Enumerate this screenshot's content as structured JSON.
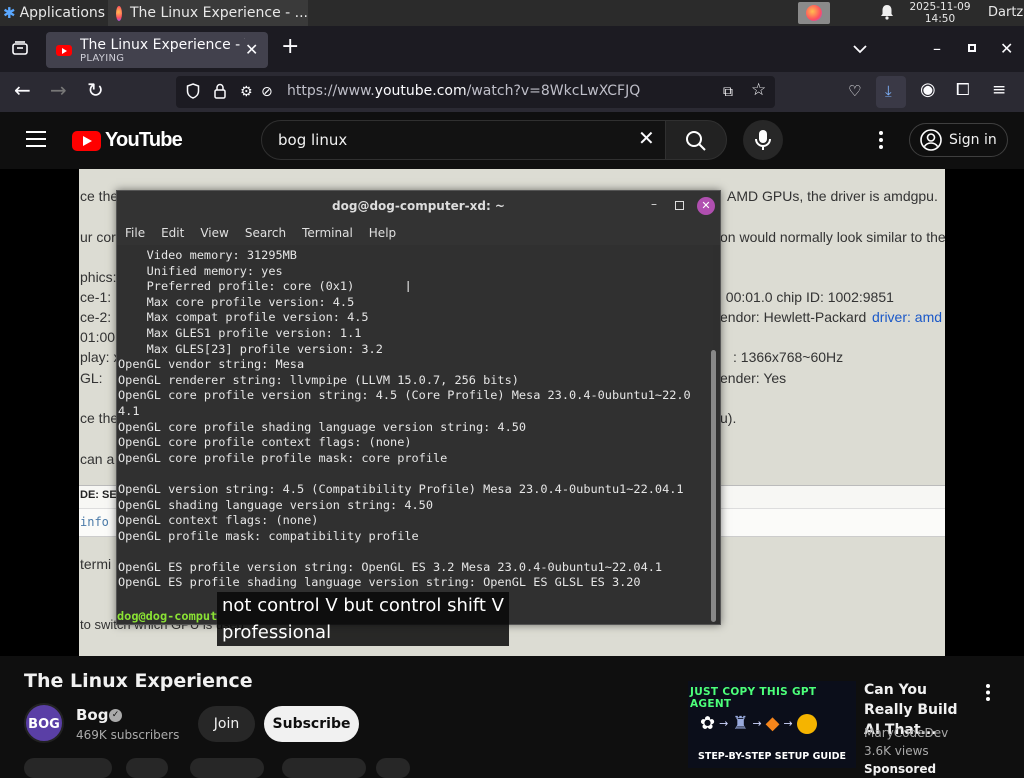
{
  "taskbar": {
    "apps_label": "Applications",
    "window_title": "The Linux Experience - ...",
    "clock_date": "2025-11-09",
    "clock_time": "14:50",
    "user": "Dartz"
  },
  "browser": {
    "tab_title": "The Linux Experience - Y",
    "tab_status": "PLAYING",
    "url_prefix": "https://www.",
    "url_domain": "youtube.com",
    "url_path": "/watch?v=8WkcLwXCFJQ"
  },
  "youtube": {
    "logo_text": "YouTube",
    "search_value": "bog linux",
    "sign_in": "Sign in"
  },
  "slide": {
    "lines": [
      "ce the",
      "AMD GPUs, the driver is amdgpu.",
      "ur cor",
      "on would normally look similar to the",
      "phics:",
      "ce-1:",
      ": 00:01.0 chip ID: 1002:9851",
      "ce-2:",
      "endor: Hewlett-Packard",
      "driver: amd",
      "01:00.",
      "play: x",
      ": 1366x768~60Hz",
      "GL:",
      "ender: Yes",
      "ce the",
      "u).",
      "can a",
      "DE: SE",
      "info",
      "termi",
      "to switch which GPU is used"
    ]
  },
  "terminal": {
    "title": "dog@dog-computer-xd: ~",
    "menu": [
      "File",
      "Edit",
      "View",
      "Search",
      "Terminal",
      "Help"
    ],
    "output": [
      "    Video memory: 31295MB",
      "    Unified memory: yes",
      "    Preferred profile: core (0x1)",
      "    Max core profile version: 4.5",
      "    Max compat profile version: 4.5",
      "    Max GLES1 profile version: 1.1",
      "    Max GLES[23] profile version: 3.2",
      "OpenGL vendor string: Mesa",
      "OpenGL renderer string: llvmpipe (LLVM 15.0.7, 256 bits)",
      "OpenGL core profile version string: 4.5 (Core Profile) Mesa 23.0.4-0ubuntu1~22.0",
      "4.1",
      "OpenGL core profile shading language version string: 4.50",
      "OpenGL core profile context flags: (none)",
      "OpenGL core profile profile mask: core profile",
      "",
      "OpenGL version string: 4.5 (Compatibility Profile) Mesa 23.0.4-0ubuntu1~22.04.1",
      "OpenGL shading language version string: 4.50",
      "OpenGL context flags: (none)",
      "OpenGL profile mask: compatibility profile",
      "",
      "OpenGL ES profile version string: OpenGL ES 3.2 Mesa 23.0.4-0ubuntu1~22.04.1",
      "OpenGL ES profile shading language version string: OpenGL ES GLSL ES 3.20"
    ],
    "prompt": "dog@dog-comput"
  },
  "caption": {
    "line1": "not control V but control shift V",
    "line2": "professional"
  },
  "video": {
    "title": "The Linux Experience",
    "channel": "Bog",
    "avatar_text": "BOG",
    "subscribers": "469K subscribers",
    "join": "Join",
    "subscribe": "Subscribe"
  },
  "recommended": {
    "thumb_top": "JUST COPY THIS GPT AGENT",
    "thumb_bottom": "STEP-BY-STEP SETUP GUIDE",
    "title": "Can You Really Build AI That...",
    "channel": "MaryCodeDev",
    "views": "3.6K views",
    "sponsored": "Sponsored"
  },
  "colors": {
    "youtube_red": "#ff0000",
    "terminal_bg": "#303030",
    "slide_bg": "#dcdcd3",
    "prompt_green": "#8ae234"
  }
}
